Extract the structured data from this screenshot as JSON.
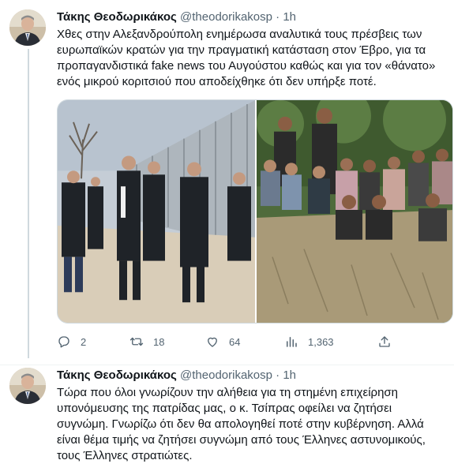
{
  "tweets": [
    {
      "name": "Τάκης Θεοδωρικάκος",
      "handle": "@theodorikakosp",
      "separator": "·",
      "time": "1h",
      "text": "Χθες στην Αλεξανδρούπολη ενημέρωσα αναλυτικά τους πρέσβεις των\nευρωπαϊκών κρατών για την πραγματική κατάσταση  στον Έβρο, για τα\nπροπαγανδιστικά fake news του Αυγούστου καθώς και για τον «θάνατο»\nενός μικρού κοριτσιού που αποδείχθηκε ότι δεν υπήρξε ποτέ.",
      "actions": {
        "reply_count": "2",
        "retweet_count": "18",
        "like_count": "64",
        "views_count": "1,363"
      }
    },
    {
      "name": "Τάκης Θεοδωρικάκος",
      "handle": "@theodorikakosp",
      "separator": "·",
      "time": "1h",
      "text": "Τώρα που όλοι γνωρίζουν την αλήθεια για τη στημένη επιχείρηση\nυπονόμευσης της πατρίδας μας, ο κ. Τσίπρας οφείλει να ζητήσει\nσυγνώμη. Γνωρίζω ότι δεν θα απολογηθεί ποτέ στην κυβέρνηση. Αλλά\nείναι θέμα τιμής να ζητήσει συγνώμη από τους Έλληνες αστυνομικούς,\nτους Έλληνες στρατιώτες."
    }
  ],
  "colors": {
    "text": "#0f1419",
    "secondary": "#536471",
    "thread_line": "#cfd9de"
  },
  "icons": [
    "reply-icon",
    "retweet-icon",
    "like-icon",
    "views-icon",
    "share-icon"
  ]
}
